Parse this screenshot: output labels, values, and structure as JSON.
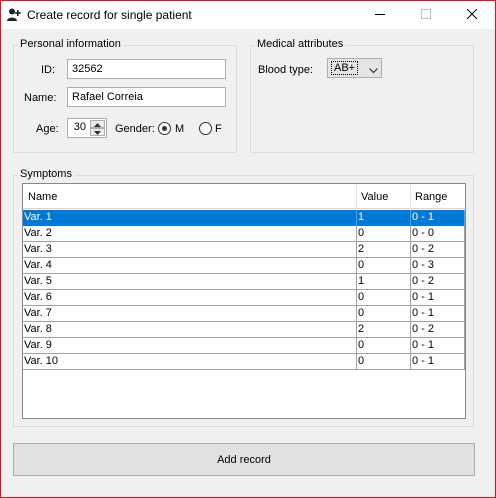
{
  "window": {
    "title": "Create record for single patient",
    "icon": "add-user-icon"
  },
  "personal": {
    "legend": "Personal information",
    "id_label": "ID:",
    "id_value": "32562",
    "name_label": "Name:",
    "name_value": "Rafael Correia",
    "age_label": "Age:",
    "age_value": "30",
    "gender_label": "Gender:",
    "gender_m": "M",
    "gender_f": "F",
    "gender_selected": "M"
  },
  "medical": {
    "legend": "Medical attributes",
    "blood_label": "Blood type:",
    "blood_value": "AB+"
  },
  "symptoms": {
    "legend": "Symptoms",
    "columns": [
      "Name",
      "Value",
      "Range"
    ],
    "rows": [
      {
        "name": "Var. 1",
        "value": "1",
        "range": "0 - 1"
      },
      {
        "name": "Var. 2",
        "value": "0",
        "range": "0 - 0"
      },
      {
        "name": "Var. 3",
        "value": "2",
        "range": "0 - 2"
      },
      {
        "name": "Var. 4",
        "value": "0",
        "range": "0 - 3"
      },
      {
        "name": "Var. 5",
        "value": "1",
        "range": "0 - 2"
      },
      {
        "name": "Var. 6",
        "value": "0",
        "range": "0 - 1"
      },
      {
        "name": "Var. 7",
        "value": "0",
        "range": "0 - 1"
      },
      {
        "name": "Var. 8",
        "value": "2",
        "range": "0 - 2"
      },
      {
        "name": "Var. 9",
        "value": "0",
        "range": "0 - 1"
      },
      {
        "name": "Var. 10",
        "value": "0",
        "range": "0 - 1"
      }
    ],
    "selected_row": 0
  },
  "actions": {
    "add_label": "Add record"
  },
  "colors": {
    "accent": "#0078d7",
    "close_border": "#e81123"
  }
}
